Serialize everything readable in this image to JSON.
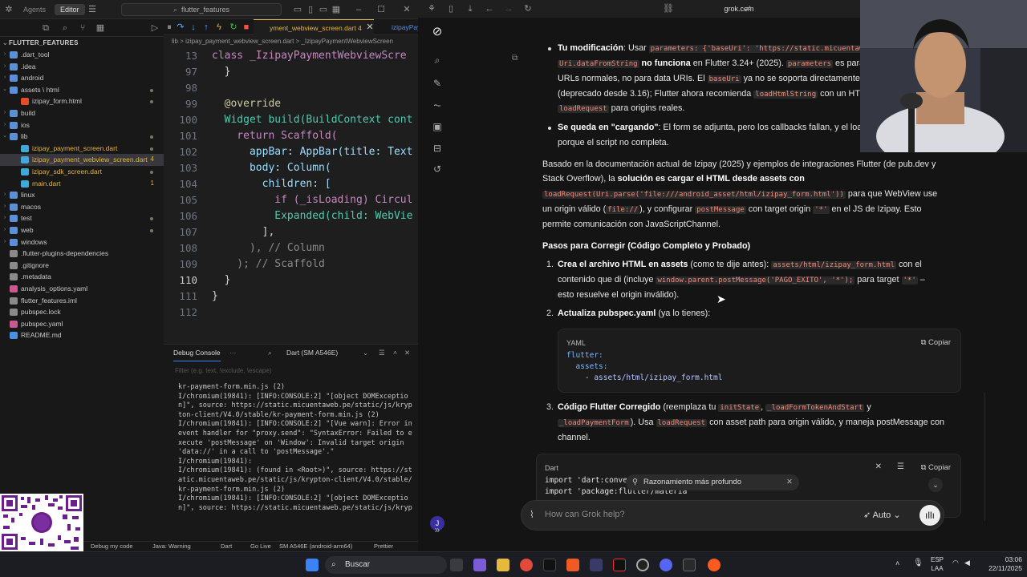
{
  "ide": {
    "modes": [
      "Agents",
      "Editor"
    ],
    "search": "flutter_features",
    "explorer_title": "FLUTTER_FEATURES",
    "tree": [
      {
        "label": ".dart_tool",
        "kind": "folder",
        "depth": 1,
        "open": false
      },
      {
        "label": ".idea",
        "kind": "folder",
        "depth": 1,
        "open": false
      },
      {
        "label": "android",
        "kind": "folder",
        "depth": 1,
        "open": false
      },
      {
        "label": "assets \\ html",
        "kind": "folder",
        "depth": 1,
        "open": true
      },
      {
        "label": "izipay_form.html",
        "kind": "html",
        "depth": 2
      },
      {
        "label": "build",
        "kind": "folder",
        "depth": 1,
        "open": false
      },
      {
        "label": "ios",
        "kind": "folder",
        "depth": 1,
        "open": false
      },
      {
        "label": "lib",
        "kind": "folder",
        "depth": 1,
        "open": true
      },
      {
        "label": "izipay_payment_screen.dart",
        "kind": "dart",
        "depth": 2
      },
      {
        "label": "izipay_payment_webview_screen.dart",
        "kind": "dart",
        "depth": 2,
        "selected": true,
        "badge": "4"
      },
      {
        "label": "izipay_sdk_screen.dart",
        "kind": "dart",
        "depth": 2
      },
      {
        "label": "main.dart",
        "kind": "dart",
        "depth": 2,
        "badge": "1",
        "warn": true
      },
      {
        "label": "linux",
        "kind": "folder",
        "depth": 1,
        "open": false
      },
      {
        "label": "macos",
        "kind": "folder",
        "depth": 1,
        "open": false
      },
      {
        "label": "test",
        "kind": "folder",
        "depth": 1,
        "open": false
      },
      {
        "label": "web",
        "kind": "folder",
        "depth": 1,
        "open": false
      },
      {
        "label": "windows",
        "kind": "folder",
        "depth": 1,
        "open": false
      },
      {
        "label": ".flutter-plugins-dependencies",
        "kind": "file",
        "depth": 1
      },
      {
        "label": ".gitignore",
        "kind": "file",
        "depth": 1
      },
      {
        "label": ".metadata",
        "kind": "file",
        "depth": 1
      },
      {
        "label": "analysis_options.yaml",
        "kind": "yaml",
        "depth": 1
      },
      {
        "label": "flutter_features.iml",
        "kind": "file",
        "depth": 1
      },
      {
        "label": "pubspec.lock",
        "kind": "file",
        "depth": 1
      },
      {
        "label": "pubspec.yaml",
        "kind": "yaml",
        "depth": 1
      },
      {
        "label": "README.md",
        "kind": "md",
        "depth": 1
      }
    ],
    "tabs": [
      {
        "label": "yment_webview_screen.dart 4",
        "active": true
      },
      {
        "label": "izipayPaymentWebv",
        "active": false
      }
    ],
    "breadcrumb": "lib  >  izipay_payment_webview_screen.dart  >  _IzipayPaymentWebviewScreen",
    "code_lines": [
      {
        "n": "13",
        "t": "class _IzipayPaymentWebviewScre"
      },
      {
        "n": "97",
        "t": "  }"
      },
      {
        "n": "98",
        "t": ""
      },
      {
        "n": "99",
        "t": "  @override"
      },
      {
        "n": "100",
        "t": "  Widget build(BuildContext cont"
      },
      {
        "n": "101",
        "t": "    return Scaffold("
      },
      {
        "n": "102",
        "t": "      appBar: AppBar(title: Text"
      },
      {
        "n": "103",
        "t": "      body: Column("
      },
      {
        "n": "104",
        "t": "        children: ["
      },
      {
        "n": "105",
        "t": "          if (_isLoading) Circul"
      },
      {
        "n": "106",
        "t": "          Expanded(child: WebVie"
      },
      {
        "n": "107",
        "t": "        ],"
      },
      {
        "n": "108",
        "t": "      ), // Column"
      },
      {
        "n": "109",
        "t": "    ); // Scaffold"
      },
      {
        "n": "110",
        "t": "  }"
      },
      {
        "n": "111",
        "t": "}"
      },
      {
        "n": "112",
        "t": ""
      }
    ],
    "debug": {
      "title": "Debug Console",
      "device": "Dart (SM A546E)",
      "filter_placeholder": "Filter (e.g. text, !exclude, \\escape)",
      "lines": [
        "kr-payment-form.min.js (2)",
        "I/chromium(19841): [INFO:CONSOLE:2] \"[object DOMExceptio",
        "n]\", source: https://static.micuentaweb.pe/static/js/kryp",
        "ton-client/V4.0/stable/kr-payment-form.min.js (2)",
        "I/chromium(19841): [INFO:CONSOLE:2] \"[Vue warn]: Error in",
        "event handler for \"proxy.send\": \"SyntaxError: Failed to e",
        "xecute 'postMessage' on 'Window': Invalid target origin",
        "'data://' in a call to 'postMessage'.\"",
        "I/chromium(19841):",
        "I/chromium(19841): (found in <Root>)\", source: https://st",
        "atic.micuentaweb.pe/static/js/krypton-client/V4.0/stable/",
        "kr-payment-form.min.js (2)",
        "I/chromium(19841): [INFO:CONSOLE:2] \"[object DOMExceptio",
        "n]\", source: https://static.micuentaweb.pe/static/js/kryp"
      ]
    },
    "status": [
      "Debug my code",
      "Java: Warning",
      "Dart",
      "Go Live",
      "SM A546E (android-arm64)",
      "Prettier"
    ]
  },
  "browser": {
    "url": "grok.com",
    "chat": {
      "b1_label": "Tu modificación",
      "b1_text1": ": Usar ",
      "b1_code1": "parameters: {'baseUri': 'https://static.micuentaw",
      "b1_code2": "Uri.dataFromString",
      "b1_bold2": " no funciona",
      "b1_text2": " en Flutter 3.24+ (2025). ",
      "b1_code3": "parameters",
      "b1_text3": " es para qu",
      "b1_line3a": "URLs normales, no para data URIs. El ",
      "b1_code4": "baseUri",
      "b1_line3b": " ya no se soporta directamente en",
      "b1_line4a": "(deprecado desde 3.16); Flutter ahora recomienda ",
      "b1_code5": "loadHtmlString",
      "b1_line4b": " con un HTML",
      "b1_code6": "loadRequest",
      "b1_line5": " para origins reales.",
      "b2_label": "Se queda en \"cargando\"",
      "b2_text": ": El form se adjunta, pero los callbacks fallan, y el loading",
      "b2_line2": "porque el script no completa.",
      "p1_l1": "Basado en la documentación actual de Izipay (2025) y ejemplos de integraciones Flutter (de pub.dev y",
      "p1_l2a": "Stack Overflow), la ",
      "p1_l2b": "solución es cargar el HTML desde assets con",
      "p1_code1": "loadRequest(Uri.parse('file:///android_asset/html/izipay_form.html'))",
      "p1_l3": " para que WebView use",
      "p1_l4a": "un origin válido (",
      "p1_code2": "file://",
      "p1_l4b": "), y configurar ",
      "p1_code3": "postMessage",
      "p1_l4c": " con target origin ",
      "p1_code4": "'*'",
      "p1_l4d": " en el JS de Izipay. Esto",
      "p1_l5": "permite comunicación con JavaScriptChannel.",
      "h_steps": "Pasos para Corregir (Código Completo y Probado)",
      "s1_num": "1.",
      "s1_bold": "Crea el archivo HTML en assets",
      "s1_text": " (como te dije antes): ",
      "s1_code": "assets/html/izipay_form.html",
      "s1_text2": " con el",
      "s1_l2a": "contenido que di (incluye ",
      "s1_code2": "window.parent.postMessage('PAGO_EXITO', '*');",
      "s1_l2b": " para target ",
      "s1_code3": "'*'",
      "s1_l2c": " –",
      "s1_l3": "esto resuelve el origin inválido).",
      "s2_num": "2.",
      "s2_bold": "Actualiza pubspec.yaml",
      "s2_text": " (ya lo tienes):",
      "yaml_lang": "YAML",
      "copy": "Copiar",
      "yaml_l1": "flutter:",
      "yaml_l2": "  assets:",
      "yaml_l3": "    - assets/html/izipay_form.html",
      "s3_num": "3.",
      "s3_bold": "Código Flutter Corregido",
      "s3_text": " (reemplaza tu ",
      "s3_code1": "initState",
      "s3_sep": ", ",
      "s3_code2": "_loadFormTokenAndStart",
      "s3_y": " y",
      "s3_code3": "_loadPaymentForm",
      "s3_l2a": "). Usa ",
      "s3_code4": "loadRequest",
      "s3_l2b": " con asset path para origin válido, y maneja postMessage con",
      "s3_l3": "channel.",
      "dart_lang": "Dart",
      "dart_l1": "import 'dart:convert';",
      "dart_l2": "import 'package:flutter/materia"
    },
    "chip": "Razonamiento más profundo",
    "composer_placeholder": "How can Grok help?",
    "mode": "Auto",
    "avatar": "J"
  },
  "taskbar": {
    "search": "Buscar",
    "lang": "ESP",
    "lang2": "LAA",
    "time": "03:06",
    "date": "22/11/2025"
  },
  "colors": {
    "accent": "#3b82f6",
    "keyword": "#c586c0",
    "type": "#4ec9b0",
    "func": "#dcdcaa"
  }
}
